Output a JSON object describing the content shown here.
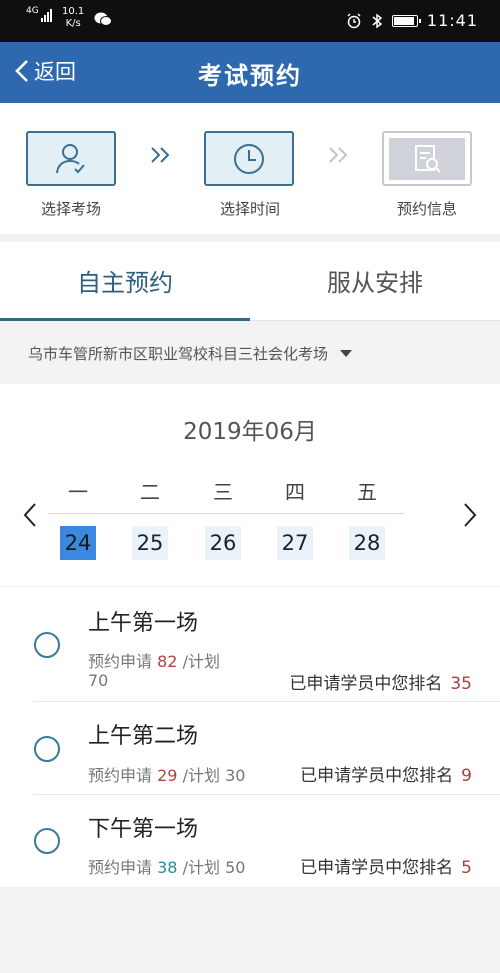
{
  "status_bar": {
    "network": "4G",
    "speed_value": "10.1",
    "speed_unit": "K/s",
    "time": "11:41",
    "battery_level": 0.9
  },
  "nav": {
    "back_label": "返回",
    "title": "考试预约"
  },
  "steps": [
    {
      "label": "选择考场",
      "icon": "person-check-icon",
      "state": "active"
    },
    {
      "label": "选择时间",
      "icon": "clock-icon",
      "state": "active"
    },
    {
      "label": "预约信息",
      "icon": "document-search-icon",
      "state": "inactive"
    }
  ],
  "tabs": [
    {
      "label": "自主预约",
      "active": true
    },
    {
      "label": "服从安排",
      "active": false
    }
  ],
  "location": "乌市车管所新市区职业驾校科目三社会化考场",
  "calendar": {
    "month": "2019年06月",
    "weekdays": [
      "一",
      "二",
      "三",
      "四",
      "五"
    ],
    "dates": [
      "24",
      "25",
      "26",
      "27",
      "28"
    ],
    "selected_index": 0
  },
  "sessions": [
    {
      "title": "上午第一场",
      "applied_label": "预约申请",
      "applied": "82",
      "applied_color": "#b0453f",
      "plan_label": "/计划",
      "plan": "70",
      "rank_label": "已申请学员中您排名",
      "rank": "35"
    },
    {
      "title": "上午第二场",
      "applied_label": "预约申请",
      "applied": "29",
      "applied_color": "#b0453f",
      "plan_label": "/计划",
      "plan": "30",
      "rank_label": "已申请学员中您排名",
      "rank": "9"
    },
    {
      "title": "下午第一场",
      "applied_label": "预约申请",
      "applied": "38",
      "applied_color": "#2f8aa0",
      "plan_label": "/计划",
      "plan": "50",
      "rank_label": "已申请学员中您排名",
      "rank": "5"
    }
  ],
  "colors": {
    "nav_bg": "#2e68ae",
    "selected_date": "#3c88e0",
    "accent": "#3a6986"
  }
}
